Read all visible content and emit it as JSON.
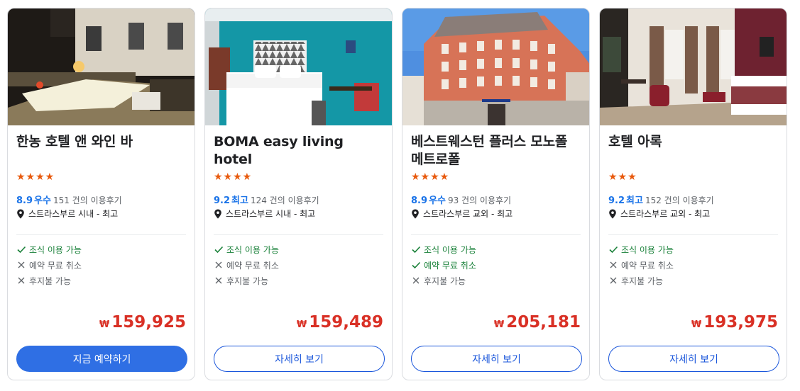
{
  "colors": {
    "accent_blue": "#1a73e8",
    "price_red": "#d93025",
    "star_orange": "#e8590c",
    "available_green": "#188038",
    "unavailable_gray": "#5f6368",
    "button_blue": "#2f6fe4"
  },
  "icons": {
    "location": "map-pin-icon",
    "available": "check-icon",
    "unavailable": "x-icon",
    "star": "★"
  },
  "hotels": [
    {
      "name": "한농 호텔 앤 와인 바",
      "stars_display": "★★★★",
      "star_count": 4,
      "score": "8.9",
      "score_word": "우수",
      "review_count": "151 건의 이용후기",
      "location": "스트라스부르 시내 - 최고",
      "features": [
        {
          "label": "조식 이용 가능",
          "available": true
        },
        {
          "label": "예약 무료 취소",
          "available": false
        },
        {
          "label": "후지불 가능",
          "available": false
        }
      ],
      "currency": "₩",
      "price": "159,925",
      "button_label": "지금 예약하기",
      "button_style": "primary"
    },
    {
      "name": "BOMA easy living hotel",
      "stars_display": "★★★★",
      "star_count": 4,
      "score": "9.2",
      "score_word": "최고",
      "review_count": "124 건의 이용후기",
      "location": "스트라스부르 시내 - 최고",
      "features": [
        {
          "label": "조식 이용 가능",
          "available": true
        },
        {
          "label": "예약 무료 취소",
          "available": false
        },
        {
          "label": "후지불 가능",
          "available": false
        }
      ],
      "currency": "₩",
      "price": "159,489",
      "button_label": "자세히 보기",
      "button_style": "outline"
    },
    {
      "name": "베스트웨스턴 플러스 모노폴 메트로폴",
      "stars_display": "★★★★",
      "star_count": 4,
      "score": "8.9",
      "score_word": "우수",
      "review_count": "93 건의 이용후기",
      "location": "스트라스부르 교외 - 최고",
      "features": [
        {
          "label": "조식 이용 가능",
          "available": true
        },
        {
          "label": "예약 무료 취소",
          "available": true
        },
        {
          "label": "후지불 가능",
          "available": false
        }
      ],
      "currency": "₩",
      "price": "205,181",
      "button_label": "자세히 보기",
      "button_style": "outline"
    },
    {
      "name": "호텔 아록",
      "stars_display": "★★★",
      "star_count": 3,
      "score": "9.2",
      "score_word": "최고",
      "review_count": "152 건의 이용후기",
      "location": "스트라스부르 교외 - 최고",
      "features": [
        {
          "label": "조식 이용 가능",
          "available": true
        },
        {
          "label": "예약 무료 취소",
          "available": false
        },
        {
          "label": "후지불 가능",
          "available": false
        }
      ],
      "currency": "₩",
      "price": "193,975",
      "button_label": "자세히 보기",
      "button_style": "outline"
    }
  ]
}
